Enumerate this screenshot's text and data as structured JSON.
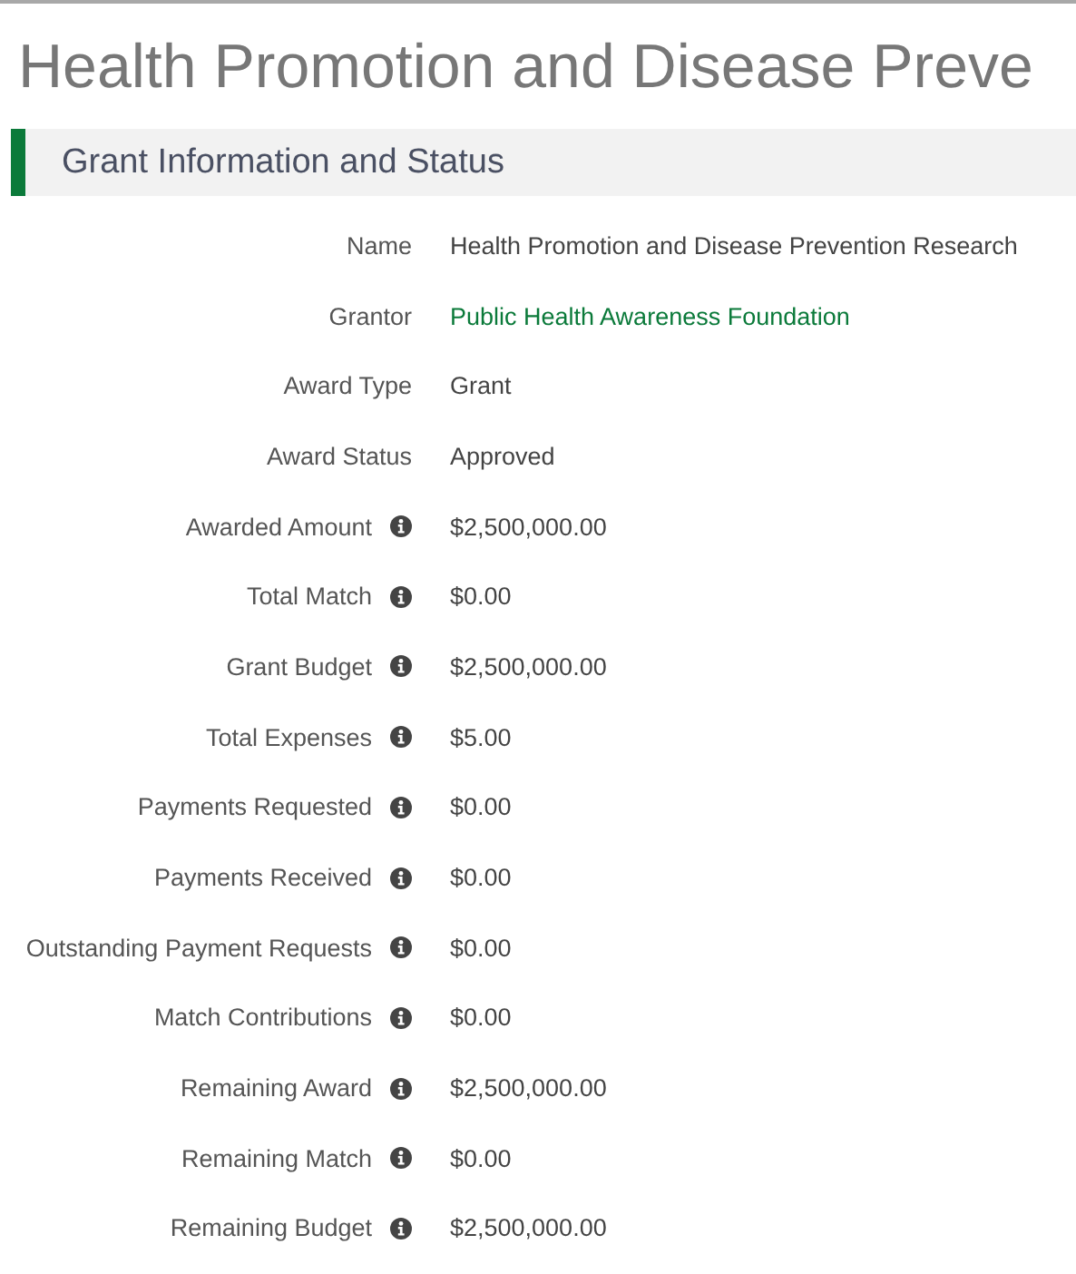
{
  "page_title": "Health Promotion and Disease Preve",
  "section": {
    "title": "Grant Information and Status"
  },
  "fields": [
    {
      "label": "Name",
      "value": "Health Promotion and Disease Prevention Research",
      "kind": "text",
      "info": false
    },
    {
      "label": "Grantor",
      "value": "Public Health Awareness Foundation",
      "kind": "link",
      "info": false
    },
    {
      "label": "Award Type",
      "value": "Grant",
      "kind": "text",
      "info": false
    },
    {
      "label": "Award Status",
      "value": "Approved",
      "kind": "text",
      "info": false
    },
    {
      "label": "Awarded Amount",
      "value": "$2,500,000.00",
      "kind": "text",
      "info": true
    },
    {
      "label": "Total Match",
      "value": "$0.00",
      "kind": "text",
      "info": true
    },
    {
      "label": "Grant Budget",
      "value": "$2,500,000.00",
      "kind": "text",
      "info": true
    },
    {
      "label": "Total Expenses",
      "value": "$5.00",
      "kind": "text",
      "info": true
    },
    {
      "label": "Payments Requested",
      "value": "$0.00",
      "kind": "text",
      "info": true
    },
    {
      "label": "Payments Received",
      "value": "$0.00",
      "kind": "text",
      "info": true
    },
    {
      "label": "Outstanding Payment Requests",
      "value": "$0.00",
      "kind": "text",
      "info": true
    },
    {
      "label": "Match Contributions",
      "value": "$0.00",
      "kind": "text",
      "info": true
    },
    {
      "label": "Remaining Award",
      "value": "$2,500,000.00",
      "kind": "text",
      "info": true
    },
    {
      "label": "Remaining Match",
      "value": "$0.00",
      "kind": "text",
      "info": true
    },
    {
      "label": "Remaining Budget",
      "value": "$2,500,000.00",
      "kind": "text",
      "info": true
    }
  ]
}
